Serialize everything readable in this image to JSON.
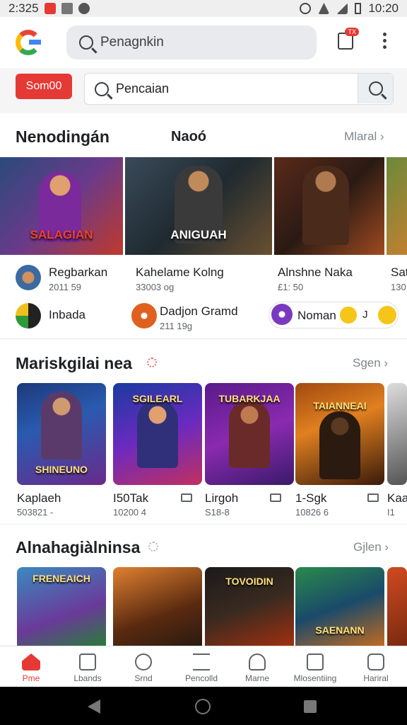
{
  "status_bar": {
    "time": "2:325",
    "clock": "10:20"
  },
  "top_search": {
    "placeholder": "Penagnkin"
  },
  "notif_badge": "TX",
  "bar2": {
    "button": "Som00",
    "search_text": "Pencaian"
  },
  "section1": {
    "title": "Nenodingán",
    "subtitle": "Naoó",
    "more": "Mlaral ›"
  },
  "banners": [
    {
      "caption": "SALAGIAN"
    },
    {
      "caption": "ANIGUAH"
    },
    {
      "caption": ""
    },
    {
      "caption": ""
    }
  ],
  "channels_row1": [
    {
      "name": "Regbarkan",
      "meta": "2011 59"
    },
    {
      "name": "Kahelame Kolng",
      "meta": "33003 og"
    },
    {
      "name": "Alnshne Naka",
      "meta": "£1: 50"
    },
    {
      "name": "Sat",
      "meta": "130"
    }
  ],
  "channels_row2": [
    {
      "name": "Inbada",
      "meta": ""
    },
    {
      "name": "Dadjon Gramd",
      "meta": "211 19g"
    },
    {
      "name": "Noman",
      "meta": "J"
    }
  ],
  "section2": {
    "title": "Mariskgilai nea",
    "more": "Sgen ›",
    "cards": [
      {
        "caption": "SHINEUNO",
        "title": "Kaplaeh",
        "meta": "503821 -"
      },
      {
        "caption": "SGILEARL",
        "title": "I50Tak",
        "meta": "10200 4"
      },
      {
        "caption": "TUBARKJAA",
        "title": "Lirgoh",
        "meta": "S18-8"
      },
      {
        "caption": "TAIANNEAI",
        "title": "1-Sgk",
        "meta": "10826 6"
      },
      {
        "caption": "",
        "title": "Kaa",
        "meta": "I1"
      }
    ]
  },
  "section3": {
    "title": "Alnahagiàlninsa",
    "more": "Gjlen ›",
    "cards": [
      {
        "caption": "FRENEAICH"
      },
      {
        "caption": ""
      },
      {
        "caption": "TOVOIDIN"
      },
      {
        "caption": "SAENANN"
      },
      {
        "caption": ""
      }
    ]
  },
  "bottom_nav": [
    "Pme",
    "Lbands",
    "Srnd",
    "Pencolld",
    "Marne",
    "Mlosentiing",
    "Hariral"
  ],
  "colors": {
    "accent": "#e53935",
    "brand_blue": "#4285f4",
    "text": "#202124"
  }
}
